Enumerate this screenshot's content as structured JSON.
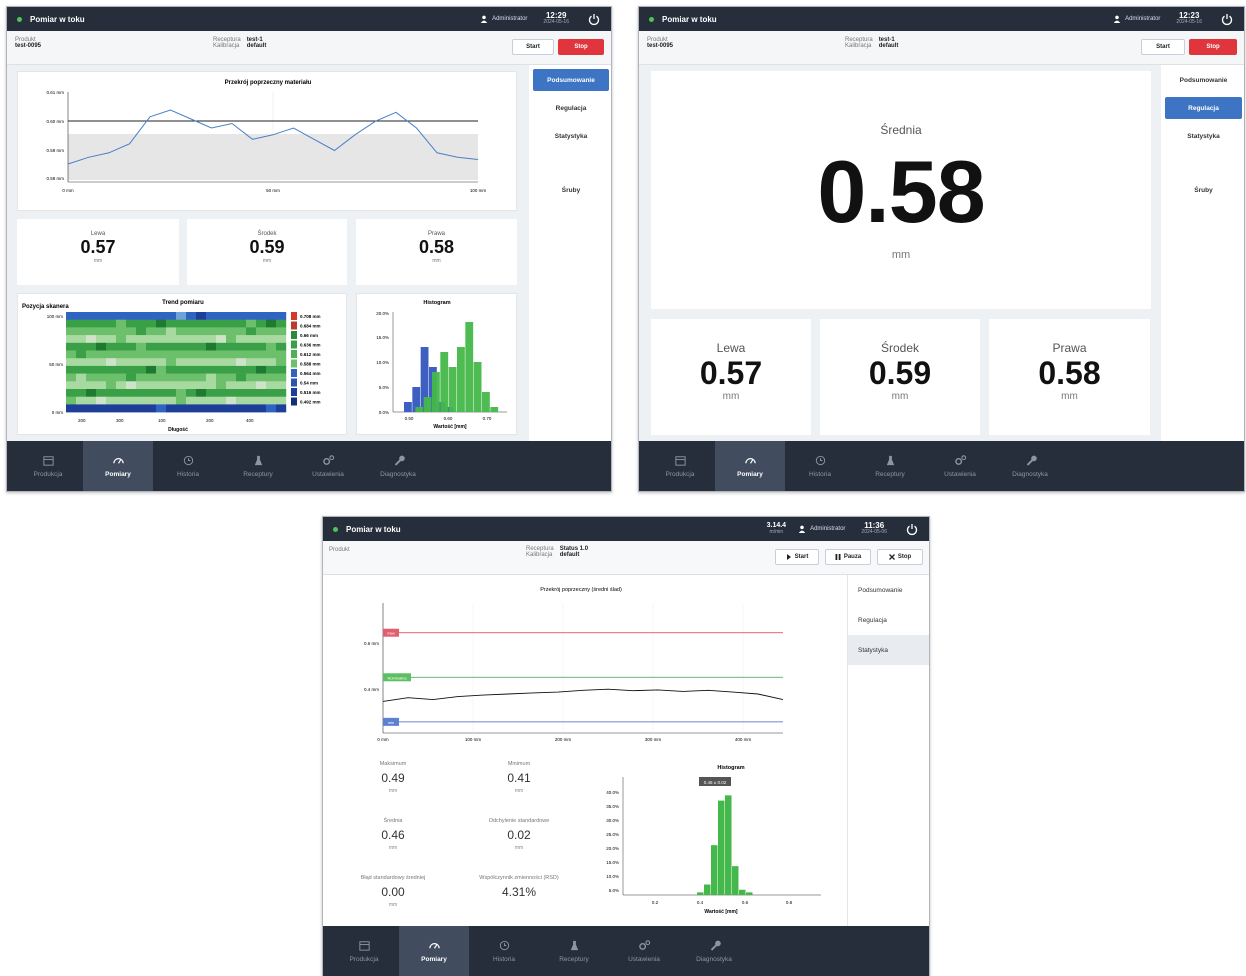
{
  "common": {
    "title": "Pomiar w toku",
    "user": "Administrator",
    "product_label": "Produkt",
    "product": "test-0095",
    "recipe_label": "Receptura",
    "recipe": "test-1",
    "calibration_label": "Kalibracja",
    "calibration": "default",
    "start": "Start",
    "stop": "Stop",
    "pause": "Pauza",
    "mm": "mm"
  },
  "nav": [
    "Produkcja",
    "Pomiary",
    "Historia",
    "Receptury",
    "Ustawienia",
    "Diagnostyka"
  ],
  "tabs": [
    "Podsumowanie",
    "Regulacja",
    "Statystyka",
    "Śruby"
  ],
  "w1": {
    "time": "12:29",
    "date": "2024-05-16",
    "chart_title": "Przekrój poprzeczny materiału",
    "ylabels": [
      "0.61 mm",
      "0.60 mm",
      "0.59 mm",
      "0.58 mm"
    ],
    "xlabels": [
      "0 mm",
      "50 mm",
      "100 mm"
    ],
    "left_label": "Lewa",
    "left": "0.57",
    "mid_label": "Środek",
    "mid": "0.59",
    "right_label": "Prawa",
    "right": "0.58",
    "trend_ylabel": "Pozycja skanera",
    "trend_title": "Trend pomiaru",
    "trend_xlabel": "Długość",
    "trend_ylabels": [
      "100 mm",
      "50 mm",
      "0 mm"
    ],
    "trend_xticks": [
      "200",
      "300",
      "100",
      "200",
      "400"
    ],
    "legend": [
      "0.708 mm",
      "0.684 mm",
      "0.66 mm",
      "0.636 mm",
      "0.612 mm",
      "0.588 mm",
      "0.564 mm",
      "0.54 mm",
      "0.516 mm",
      "0.492 mm"
    ],
    "hist_title": "Histogram",
    "hist_ylabels": [
      "20.0%",
      "15.0%",
      "10.0%",
      "5.0%",
      "0.0%"
    ],
    "hist_xlabels": [
      "0.50",
      "0.60",
      "0.70"
    ],
    "hist_xlabel": "Wartość [mm]"
  },
  "w2": {
    "time": "12:23",
    "date": "2024-05-16",
    "avg_label": "Średnia",
    "avg": "0.58",
    "left_label": "Lewa",
    "left": "0.57",
    "mid_label": "Środek",
    "mid": "0.59",
    "right_label": "Prawa",
    "right": "0.58"
  },
  "w3": {
    "time": "11:36",
    "date": "2024-05-06",
    "speed": "3.14.4",
    "speed_unit": "m/min",
    "product": "Produkt",
    "recipe": "Status 1.0",
    "chart_title": "Przekrój poprzeczny (średni ślad)",
    "ylabels": [
      "0.6 mm",
      "0.4 mm"
    ],
    "xlabels": [
      "0 mm",
      "100 mm",
      "200 mm",
      "300 mm",
      "400 mm"
    ],
    "line_max": "max",
    "line_nominal": "Nominalna",
    "line_min": "min",
    "stats": [
      {
        "label": "Maksimum",
        "value": "0.49",
        "unit": "mm"
      },
      {
        "label": "Minimum",
        "value": "0.41",
        "unit": "mm"
      },
      {
        "label": "Średnia",
        "value": "0.46",
        "unit": "mm"
      },
      {
        "label": "Odchylenie standardowe",
        "value": "0.02",
        "unit": "mm"
      },
      {
        "label": "Błąd standardowy średniej",
        "value": "0.00",
        "unit": "mm"
      },
      {
        "label": "Współczynnik zmienności (RSD)",
        "value": "4.31%",
        "unit": ""
      }
    ],
    "hist_title": "Histogram",
    "hist_badge": "0.46 ± 0.02",
    "hist_ylabels": [
      "40.0%",
      "35.0%",
      "30.0%",
      "25.0%",
      "20.0%",
      "15.0%",
      "10.0%",
      "5.0%"
    ],
    "hist_xlabels": [
      "0.2",
      "0.4",
      "0.6",
      "0.8"
    ],
    "hist_xlabel": "Wartość [mm]"
  },
  "chart_data": [
    {
      "type": "line",
      "title": "Przekrój poprzeczny materiału",
      "xlim": [
        0,
        100
      ],
      "ylim": [
        0.575,
        0.615
      ],
      "x": [
        0,
        5,
        10,
        15,
        20,
        25,
        30,
        35,
        40,
        45,
        50,
        55,
        60,
        65,
        70,
        75,
        80,
        85,
        90,
        95,
        100
      ],
      "y": [
        0.583,
        0.586,
        0.588,
        0.592,
        0.604,
        0.607,
        0.603,
        0.599,
        0.601,
        0.594,
        0.596,
        0.599,
        0.594,
        0.589,
        0.596,
        0.602,
        0.606,
        0.599,
        0.588,
        0.586,
        0.585
      ],
      "hlines": [
        0.6
      ]
    },
    {
      "type": "bar",
      "title": "Histogram",
      "xlabel": "Wartość [mm]",
      "categories": [
        "0.52",
        "0.53",
        "0.54",
        "0.55",
        "0.56",
        "0.57",
        "0.58",
        "0.59",
        "0.60",
        "0.61",
        "0.62",
        "0.63"
      ],
      "series": [
        {
          "values": [
            2,
            5,
            13,
            9,
            2,
            1,
            0,
            0,
            0,
            0,
            0,
            0
          ]
        },
        {
          "values": [
            0,
            1,
            3,
            8,
            12,
            9,
            13,
            18,
            10,
            4,
            1,
            0
          ]
        }
      ],
      "ylim": [
        0,
        20
      ]
    },
    {
      "type": "line",
      "title": "Przekrój poprzeczny (średni ślad)",
      "xlim": [
        0,
        400
      ],
      "ylim": [
        0.35,
        0.7
      ],
      "x": [
        0,
        25,
        50,
        75,
        100,
        125,
        150,
        175,
        200,
        225,
        250,
        275,
        300,
        325,
        350,
        375,
        400
      ],
      "y": [
        0.435,
        0.445,
        0.44,
        0.448,
        0.452,
        0.455,
        0.458,
        0.46,
        0.465,
        0.468,
        0.464,
        0.466,
        0.462,
        0.465,
        0.46,
        0.455,
        0.44
      ],
      "hlines": {
        "max": 0.62,
        "nominal": 0.5,
        "min": 0.38
      }
    },
    {
      "type": "bar",
      "title": "Histogram",
      "xlabel": "Wartość [mm]",
      "categories": [
        "0.42",
        "0.43",
        "0.44",
        "0.45",
        "0.46",
        "0.47",
        "0.48",
        "0.49"
      ],
      "values": [
        1,
        4,
        19,
        36,
        38,
        11,
        2,
        1
      ],
      "ylim": [
        0,
        45
      ]
    }
  ]
}
